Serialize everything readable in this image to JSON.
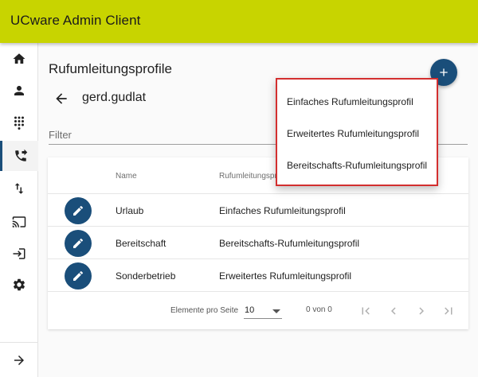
{
  "app": {
    "title": "UCware Admin Client"
  },
  "sidebar": {
    "items": [
      {
        "id": "home",
        "icon": "home-icon"
      },
      {
        "id": "users",
        "icon": "person-icon"
      },
      {
        "id": "dialpad",
        "icon": "dialpad-icon"
      },
      {
        "id": "call-forwarding",
        "icon": "phone-forward-icon",
        "active": true
      },
      {
        "id": "routing",
        "icon": "swap-vertical-icon"
      },
      {
        "id": "provisioning",
        "icon": "cast-icon"
      },
      {
        "id": "login",
        "icon": "login-icon"
      },
      {
        "id": "settings",
        "icon": "gear-icon"
      }
    ],
    "collapse_icon": "arrow-right-icon"
  },
  "page": {
    "title": "Rufumleitungsprofile",
    "username": "gerd.gudlat",
    "filter_placeholder": "Filter"
  },
  "table": {
    "columns": {
      "name": "Name",
      "profile": "Rufumleitungsprofil"
    },
    "rows": [
      {
        "name": "Urlaub",
        "profile": "Einfaches Rufumleitungsprofil"
      },
      {
        "name": "Bereitschaft",
        "profile": "Bereitschafts-Rufumleitungsprofil"
      },
      {
        "name": "Sonderbetrieb",
        "profile": "Erweitertes Rufumleitungsprofil"
      }
    ]
  },
  "paginator": {
    "label": "Elemente pro Seite",
    "page_size": "10",
    "range": "0 von 0"
  },
  "menu": {
    "items": [
      "Einfaches Rufumleitungsprofil",
      "Erweitertes Rufumleitungsprofil",
      "Bereitschafts-Rufumleitungsprofil"
    ]
  },
  "colors": {
    "topbar": "#c8d400",
    "accent": "#1a4e7a",
    "menu_highlight": "#d32f2f"
  }
}
